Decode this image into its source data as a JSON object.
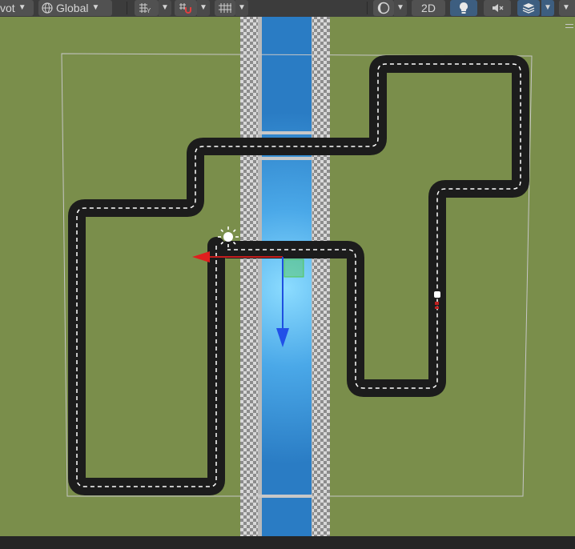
{
  "toolbar": {
    "pivot_label": "vot",
    "space_label": "Global",
    "mode_2d_label": "2D",
    "icons": [
      "globe-icon",
      "transform-grid-icon",
      "snap-magnet-icon",
      "grid-icon",
      "shading-sphere-icon",
      "lighting-bulb-icon",
      "audio-mute-icon",
      "effects-layers-icon"
    ]
  },
  "colors": {
    "grass": "#7a8e4b",
    "road": "#1c1c1c",
    "lane_marking": "#ffffff",
    "water_light": "#7dd3fb",
    "water_dark": "#2e82c7",
    "gizmo_x": "#c61d1d",
    "gizmo_z": "#1e4fe0",
    "gizmo_plane": "#53c653",
    "toolbar_bg": "#3c3c3c",
    "active_button": "#3d5e80"
  }
}
